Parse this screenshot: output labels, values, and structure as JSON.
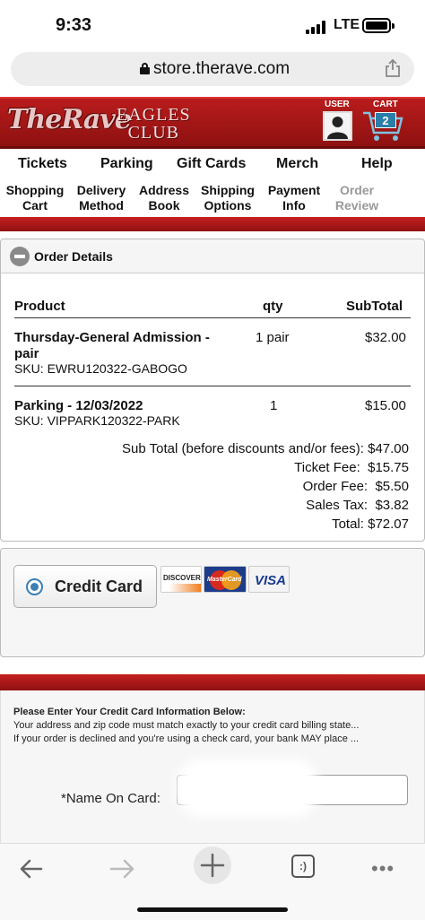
{
  "status": {
    "time": "9:33",
    "network": "LTE"
  },
  "browser": {
    "url": "store.therave.com"
  },
  "header": {
    "logo_main": "TheRave",
    "logo_sub_1": "EAGLES",
    "logo_sub_2": "CLUB",
    "user_label": "USER",
    "cart_label": "CART",
    "cart_count": "2"
  },
  "nav": {
    "items": [
      "Tickets",
      "Parking",
      "Gift Cards",
      "Merch",
      "Help"
    ]
  },
  "steps": [
    {
      "line1": "Shopping",
      "line2": "Cart"
    },
    {
      "line1": "Delivery",
      "line2": "Method"
    },
    {
      "line1": "Address",
      "line2": "Book"
    },
    {
      "line1": "Shipping",
      "line2": "Options"
    },
    {
      "line1": "Payment",
      "line2": "Info"
    },
    {
      "line1": "Order",
      "line2": "Review"
    }
  ],
  "order": {
    "title": "Order Details",
    "headers": {
      "product": "Product",
      "qty": "qty",
      "subtotal": "SubTotal"
    },
    "items": [
      {
        "name_line1": "Thursday-General Admission -",
        "name_line2": "pair",
        "sku": "SKU: EWRU120322-GABOGO",
        "qty": "1 pair",
        "subtotal": "$32.00"
      },
      {
        "name_line1": "Parking - 12/03/2022",
        "name_line2": "",
        "sku": "SKU: VIPPARK120322-PARK",
        "qty": "1",
        "subtotal": "$15.00"
      }
    ],
    "summary": [
      {
        "label": "Sub Total (before discounts and/or fees):",
        "value": "$47.00"
      },
      {
        "label": "Ticket Fee:",
        "value": "$15.75"
      },
      {
        "label": "Order Fee:",
        "value": "$5.50"
      },
      {
        "label": "Sales Tax:",
        "value": "$3.82"
      },
      {
        "label": "Total:",
        "value": "$72.07"
      }
    ]
  },
  "payment": {
    "method_label": "Credit Card",
    "cards": [
      "DISCOVER",
      "MasterCard",
      "VISA"
    ]
  },
  "form": {
    "heading": "Please Enter Your Credit Card Information Below:",
    "line1": "Your address and zip code must match exactly to your credit card billing state...",
    "line2": "If your order is declined and you're using a check card, your bank MAY place ...",
    "name_label": "*Name On Card:"
  },
  "toolbar": {
    "tabs_glyph": ":)"
  }
}
